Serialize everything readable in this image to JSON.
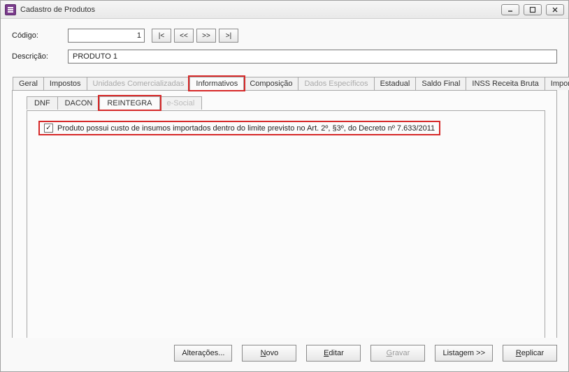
{
  "window": {
    "title": "Cadastro de Produtos"
  },
  "form": {
    "code_label": "Código:",
    "code_value": "1",
    "desc_label": "Descrição:",
    "desc_value": "PRODUTO 1",
    "nav": {
      "first": "|<",
      "prev": "<<",
      "next": ">>",
      "last": ">|"
    }
  },
  "tabs": {
    "main": [
      "Geral",
      "Impostos",
      "Unidades Comercializadas",
      "Informativos",
      "Composição",
      "Dados Específicos",
      "Estadual",
      "Saldo Final",
      "INSS Receita Bruta",
      "Importações"
    ],
    "main_active": "Informativos",
    "main_disabled": [
      "Unidades Comercializadas",
      "Dados Específicos"
    ],
    "main_highlight": "Informativos",
    "sub": [
      "DNF",
      "DACON",
      "REINTEGRA",
      "e-Social"
    ],
    "sub_active": "REINTEGRA",
    "sub_disabled": [
      "e-Social"
    ],
    "sub_highlight": "REINTEGRA"
  },
  "panel": {
    "checkbox_checked": true,
    "checkbox_label": "Produto possui custo de insumos importados dentro do limite previsto no Art. 2º, §3º, do Decreto nº 7.633/2011"
  },
  "buttons": {
    "alteracoes": "Alterações...",
    "novo": "Novo",
    "editar": "Editar",
    "gravar": "Gravar",
    "listagem": "Listagem >>",
    "replicar": "Replicar"
  }
}
